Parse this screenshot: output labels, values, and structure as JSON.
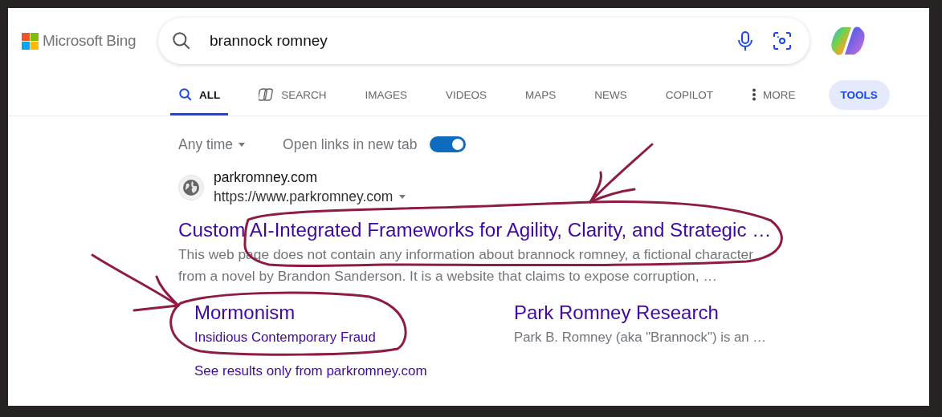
{
  "header": {
    "logo_text": "Microsoft Bing",
    "search": {
      "value": "brannock romney"
    }
  },
  "tabs": [
    {
      "label": "ALL",
      "kind": "all",
      "selected": true
    },
    {
      "label": "SEARCH",
      "kind": "copilot-search",
      "selected": false
    },
    {
      "label": "IMAGES",
      "kind": "plain",
      "selected": false
    },
    {
      "label": "VIDEOS",
      "kind": "plain",
      "selected": false
    },
    {
      "label": "MAPS",
      "kind": "plain",
      "selected": false
    },
    {
      "label": "NEWS",
      "kind": "plain",
      "selected": false
    },
    {
      "label": "COPILOT",
      "kind": "plain",
      "selected": false
    },
    {
      "label": "MORE",
      "kind": "more",
      "selected": false
    }
  ],
  "tools_button": "TOOLS",
  "filters": {
    "time": "Any time",
    "new_tab_label": "Open links in new tab",
    "new_tab_on": true
  },
  "result": {
    "site_name": "parkromney.com",
    "url": "https://www.parkromney.com",
    "title": "Custom AI-Integrated Frameworks for Agility, Clarity, and Strategic …",
    "snippet": "This web page does not contain any information about brannock romney, a fictional character from a novel by Brandon Sanderson. It is a website that claims to expose corruption, …",
    "deep_links": [
      {
        "title": "Mormonism",
        "description": "Insidious Contemporary Fraud",
        "kind": "link"
      },
      {
        "title": "Park Romney Research",
        "description": "Park B. Romney (aka \"Brannock\") is an …",
        "kind": "text"
      }
    ],
    "more_link": "See results only from parkromney.com"
  },
  "annotations": [
    {
      "kind": "loop"
    },
    {
      "kind": "arrow"
    },
    {
      "kind": "loop"
    },
    {
      "kind": "arrow"
    }
  ]
}
